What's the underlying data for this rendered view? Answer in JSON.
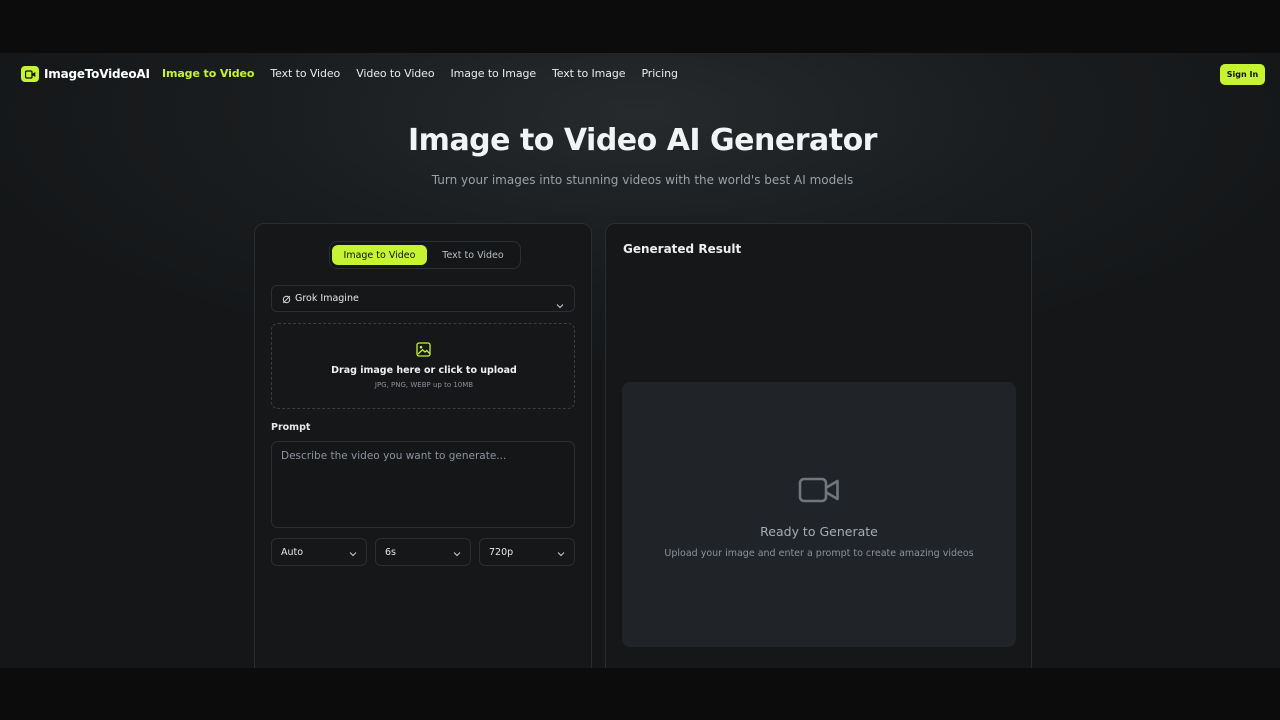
{
  "brand": {
    "name": "ImageToVideoAI",
    "icon": "video-camera-icon",
    "accent": "#c6f432"
  },
  "nav": {
    "links": [
      {
        "label": "Image to Video",
        "active": true
      },
      {
        "label": "Text to Video"
      },
      {
        "label": "Video to Video"
      },
      {
        "label": "Image to Image"
      },
      {
        "label": "Text to Image"
      },
      {
        "label": "Pricing"
      }
    ],
    "signin_label": "Sign In"
  },
  "hero": {
    "title": "Image to Video AI Generator",
    "subtitle": "Turn your images into stunning videos with the world's best AI models"
  },
  "generator": {
    "tabs": [
      {
        "label": "Image to Video",
        "active": true
      },
      {
        "label": "Text to Video"
      }
    ],
    "model": {
      "label": "Grok Imagine",
      "icon": "grok-icon"
    },
    "upload": {
      "icon": "image-icon",
      "title": "Drag image here or click to upload",
      "hint": "JPG, PNG, WEBP up to 10MB"
    },
    "prompt": {
      "label": "Prompt",
      "placeholder": "Describe the video you want to generate...",
      "value": ""
    },
    "options": {
      "aspect": "Auto",
      "duration": "6s",
      "resolution": "720p"
    }
  },
  "result": {
    "title": "Generated Result",
    "empty_icon": "video-camera-icon",
    "empty_title": "Ready to Generate",
    "empty_subtitle": "Upload your image and enter a prompt to create amazing videos"
  }
}
